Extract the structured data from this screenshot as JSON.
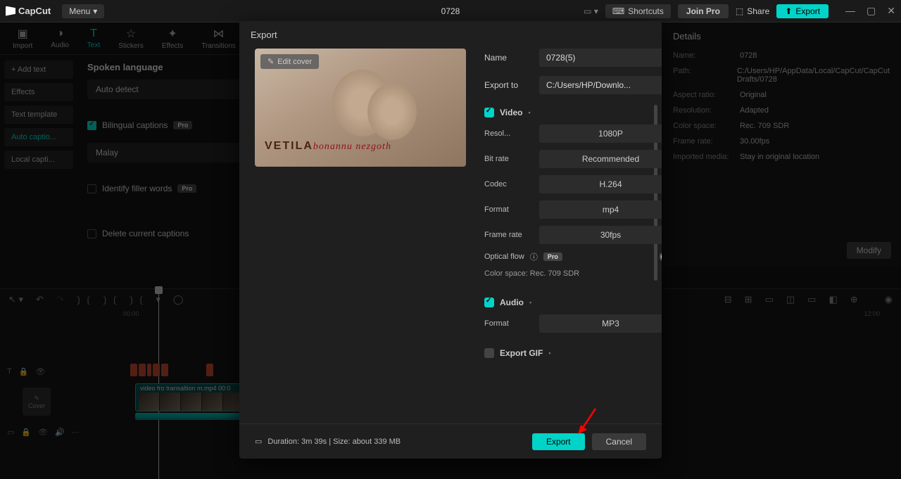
{
  "app": {
    "name": "CapCut",
    "menu": "Menu",
    "project": "0728"
  },
  "titlebar": {
    "shortcuts": "Shortcuts",
    "join_pro": "Join Pro",
    "share": "Share",
    "export": "Export"
  },
  "tabs": {
    "import": "Import",
    "audio": "Audio",
    "text": "Text",
    "stickers": "Stickers",
    "effects": "Effects",
    "transitions": "Transitions"
  },
  "sidebar": {
    "add_text": "Add text",
    "effects": "Effects",
    "text_template": "Text template",
    "auto_captions": "Auto captio...",
    "local_captions": "Local capti..."
  },
  "middle": {
    "title": "Spoken language",
    "auto_detect": "Auto detect",
    "bilingual": "Bilingual captions",
    "malay": "Malay",
    "filler": "Identify filler words",
    "delete_captions": "Delete current captions",
    "pro": "Pro"
  },
  "details": {
    "title": "Details",
    "name_k": "Name:",
    "name_v": "0728",
    "path_k": "Path:",
    "path_v": "C:/Users/HP/AppData/Local/CapCut/CapCut Drafts/0728",
    "aspect_k": "Aspect ratio:",
    "aspect_v": "Original",
    "res_k": "Resolution:",
    "res_v": "Adapted",
    "color_k": "Color space:",
    "color_v": "Rec. 709 SDR",
    "fr_k": "Frame rate:",
    "fr_v": "30.00fps",
    "media_k": "Imported media:",
    "media_v": "Stay in original location",
    "modify": "Modify"
  },
  "timeline": {
    "t0": "00:00",
    "t1": "12:00",
    "clip_name": "video fro transaltion m.mp4  00:0",
    "cover": "Cover"
  },
  "modal": {
    "title": "Export",
    "edit_cover": "Edit cover",
    "preview_word1": "VETILA",
    "preview_word2": "bonannu nezgoth",
    "name_label": "Name",
    "name_value": "0728(5)",
    "exportto_label": "Export to",
    "exportto_value": "C:/Users/HP/Downlo...",
    "video_section": "Video",
    "resolution_label": "Resol...",
    "resolution_value": "1080P",
    "bitrate_label": "Bit rate",
    "bitrate_value": "Recommended",
    "codec_label": "Codec",
    "codec_value": "H.264",
    "format_label": "Format",
    "format_value": "mp4",
    "framerate_label": "Frame rate",
    "framerate_value": "30fps",
    "optical_flow": "Optical flow",
    "colorspace_line": "Color space: Rec. 709 SDR",
    "audio_section": "Audio",
    "audio_format_label": "Format",
    "audio_format_value": "MP3",
    "gif_section": "Export GIF",
    "duration_line": "Duration: 3m 39s | Size: about 339 MB",
    "export_btn": "Export",
    "cancel_btn": "Cancel",
    "pro": "Pro"
  }
}
